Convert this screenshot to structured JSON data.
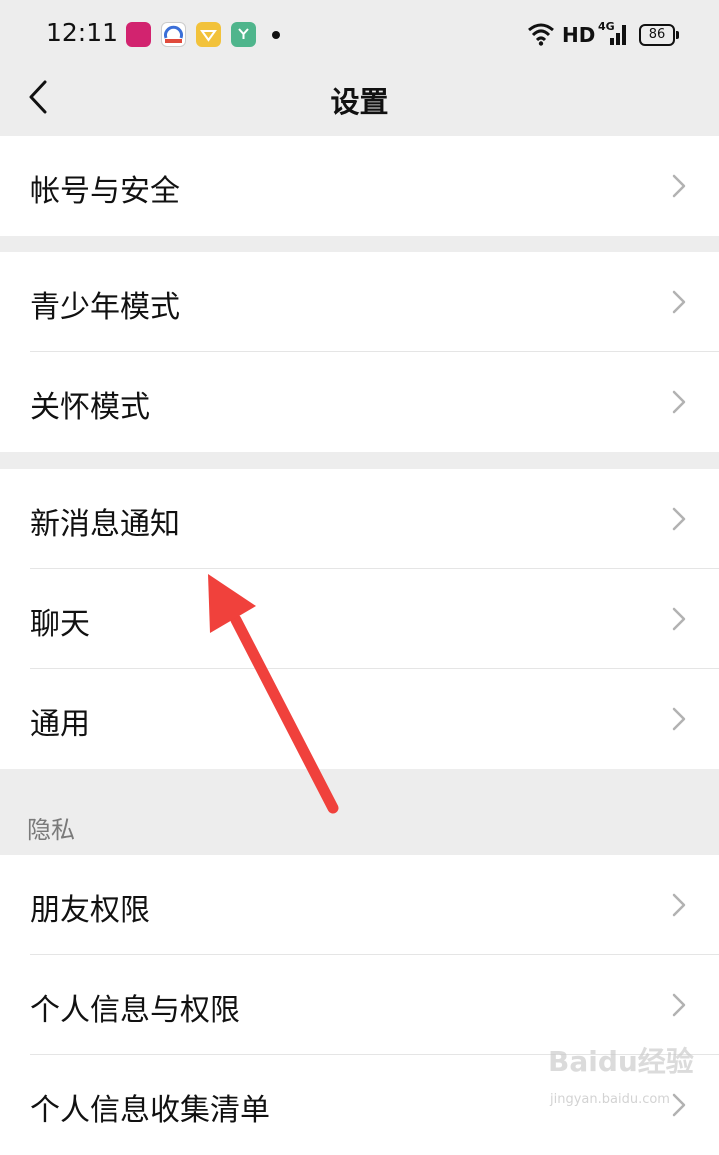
{
  "status_bar": {
    "time": "12:11",
    "network_label": "HD",
    "signal_type": "4G",
    "battery_level": "86",
    "app_icon_colors": [
      "#d2236f",
      "#e04a3c",
      "#f2c23b",
      "#4fb58c"
    ]
  },
  "nav": {
    "title": "设置",
    "back_icon": "chevron-left-icon"
  },
  "groups": [
    {
      "items": [
        {
          "label": "帐号与安全"
        }
      ]
    },
    {
      "items": [
        {
          "label": "青少年模式"
        },
        {
          "label": "关怀模式"
        }
      ]
    },
    {
      "items": [
        {
          "label": "新消息通知"
        },
        {
          "label": "聊天"
        },
        {
          "label": "通用"
        }
      ]
    },
    {
      "header": "隐私",
      "items": [
        {
          "label": "朋友权限"
        },
        {
          "label": "个人信息与权限"
        },
        {
          "label": "个人信息收集清单"
        }
      ]
    }
  ],
  "row_icon": "chevron-right-icon",
  "annotation": {
    "color": "#f0413c"
  },
  "watermark": {
    "brand": "Baidu经验",
    "url": "jingyan.baidu.com"
  }
}
